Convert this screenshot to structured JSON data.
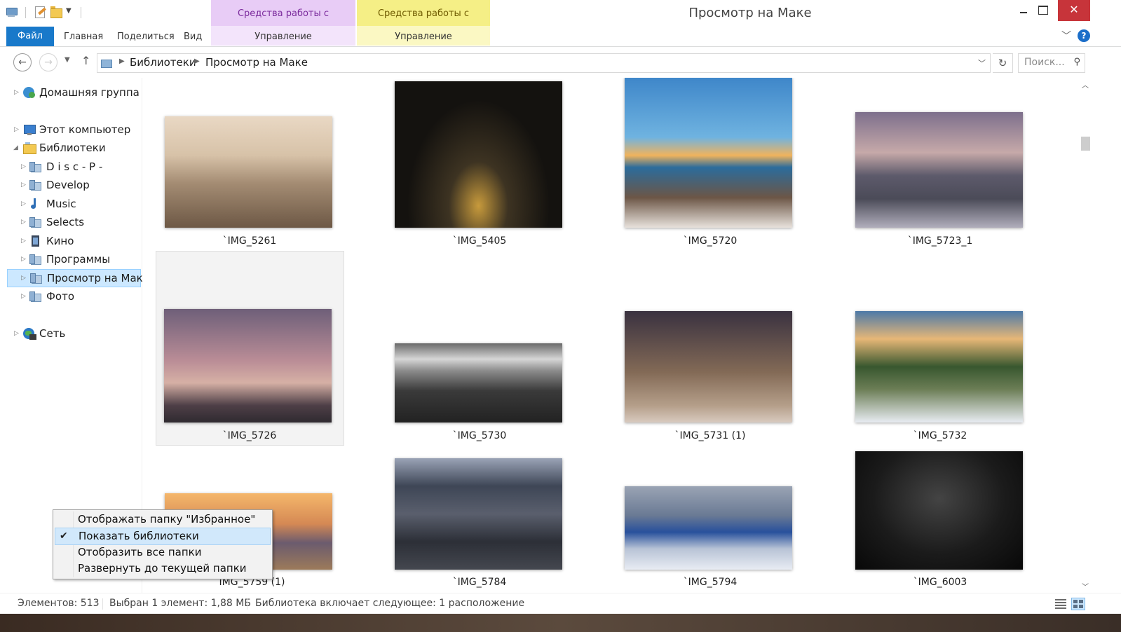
{
  "window": {
    "title": "Просмотр на Маке",
    "close_glyph": "✕"
  },
  "context_tabs": {
    "library_tools": "Средства работы с библиотекой",
    "picture_tools": "Средства работы с рисунками"
  },
  "ribbon": {
    "file": "Файл",
    "home": "Главная",
    "share": "Поделиться",
    "view": "Вид",
    "manage_library": "Управление",
    "manage_pictures": "Управление",
    "help": "?"
  },
  "address": {
    "crumbs": [
      "Библиотеки",
      "Просмотр на Маке"
    ],
    "search_placeholder": "Поиск..."
  },
  "nav_tree": {
    "homegroup": "Домашняя группа",
    "this_pc": "Этот компьютер",
    "libraries": "Библиотеки",
    "children": [
      "D i s c   - P -",
      "Develop",
      "Music",
      "Selects",
      "Кино",
      "Программы",
      "Просмотр на Маке",
      "Фото"
    ],
    "network": "Сеть"
  },
  "files": [
    {
      "name": "`IMG_5261"
    },
    {
      "name": "`IMG_5405"
    },
    {
      "name": "`IMG_5720"
    },
    {
      "name": "`IMG_5723_1"
    },
    {
      "name": "`IMG_5726"
    },
    {
      "name": "`IMG_5730"
    },
    {
      "name": "`IMG_5731 (1)"
    },
    {
      "name": "`IMG_5732"
    },
    {
      "name": "`IMG_5759 (1)"
    },
    {
      "name": "`IMG_5784"
    },
    {
      "name": "`IMG_5794"
    },
    {
      "name": "`IMG_6003"
    }
  ],
  "context_menu": {
    "items": [
      {
        "label": "Отображать папку \"Избранное\"",
        "checked": false
      },
      {
        "label": "Показать библиотеки",
        "checked": true
      },
      {
        "label": "Отобразить все папки",
        "checked": false
      },
      {
        "label": "Развернуть до текущей папки",
        "checked": false
      }
    ],
    "check_glyph": "✔"
  },
  "status": {
    "items_count": "Элементов: 513",
    "selected": "Выбран 1 элемент: 1,88 МБ",
    "library_info": "Библиотека включает следующее: 1 расположение"
  },
  "colors": {
    "file_tab": "#1979ca",
    "library_tools_bg": "#e8ccf6",
    "picture_tools_bg": "#f5ef86",
    "selection": "#cce8ff",
    "close_button": "#c7343a"
  }
}
